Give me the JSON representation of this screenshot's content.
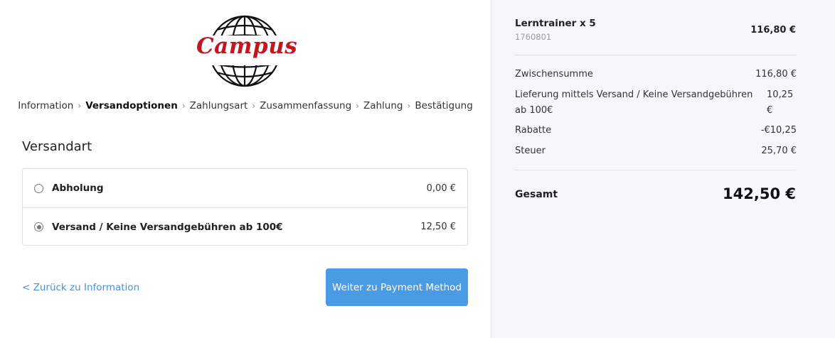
{
  "brand": {
    "logo_text": "Campus",
    "logo_color": "#c0161f"
  },
  "breadcrumb": [
    {
      "label": "Information",
      "active": false
    },
    {
      "label": "Versandoptionen",
      "active": true
    },
    {
      "label": "Zahlungsart",
      "active": false
    },
    {
      "label": "Zusammenfassung",
      "active": false
    },
    {
      "label": "Zahlung",
      "active": false
    },
    {
      "label": "Bestätigung",
      "active": false
    }
  ],
  "shipping": {
    "title": "Versandart",
    "options": [
      {
        "label": "Abholung",
        "price": "0,00 €",
        "selected": false
      },
      {
        "label": "Versand / Keine Versandgebühren ab 100€",
        "price": "12,50 €",
        "selected": true
      }
    ]
  },
  "nav": {
    "back_label": "< Zurück zu Information",
    "continue_label": "Weiter zu Payment Method"
  },
  "summary": {
    "product": {
      "name": "Lerntrainer x 5",
      "sku": "1760801",
      "price": "116,80 €"
    },
    "subtotal": {
      "label": "Zwischensumme",
      "value": "116,80 €"
    },
    "shipping": {
      "label": "Lieferung mittels Versand / Keine Versandgebühren ab 100€",
      "value": "10,25 €"
    },
    "discount": {
      "label": "Rabatte",
      "value": "-€10,25"
    },
    "tax": {
      "label": "Steuer",
      "value": "25,70 €"
    },
    "total": {
      "label": "Gesamt",
      "value": "142,50 €"
    }
  },
  "colors": {
    "accent": "#4a9be3",
    "link": "#4a90d9",
    "sidebar_bg": "#f5f8fb"
  }
}
